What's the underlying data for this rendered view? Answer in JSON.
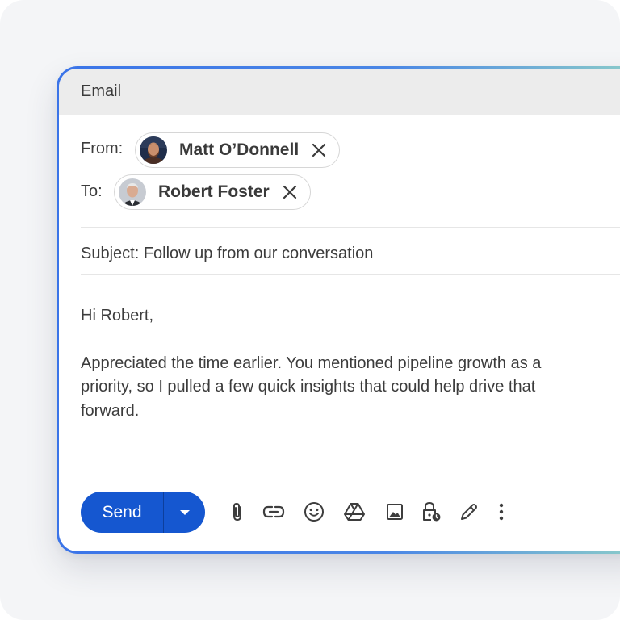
{
  "window": {
    "title": "Email"
  },
  "from": {
    "label": "From:",
    "name": "Matt O’Donnell",
    "avatar_icon": "person-avatar"
  },
  "to": {
    "label": "To:",
    "name": "Robert Foster",
    "avatar_icon": "person-avatar"
  },
  "subject": "Subject: Follow up from our conversation",
  "body": {
    "greeting": "Hi Robert,",
    "paragraph": "Appreciated the time earlier. You mentioned pipeline growth as a priority, so I pulled a few quick insights that could help drive that forward."
  },
  "toolbar": {
    "send_label": "Send",
    "icons": [
      "attach-icon",
      "link-icon",
      "emoji-icon",
      "drive-icon",
      "image-icon",
      "lock-clock-icon",
      "pen-icon",
      "more-icon"
    ]
  },
  "colors": {
    "accent": "#1557d0",
    "border_gradient_start": "#3b74e8",
    "border_gradient_end": "#8fd0c8",
    "header_bg": "#ececec"
  }
}
